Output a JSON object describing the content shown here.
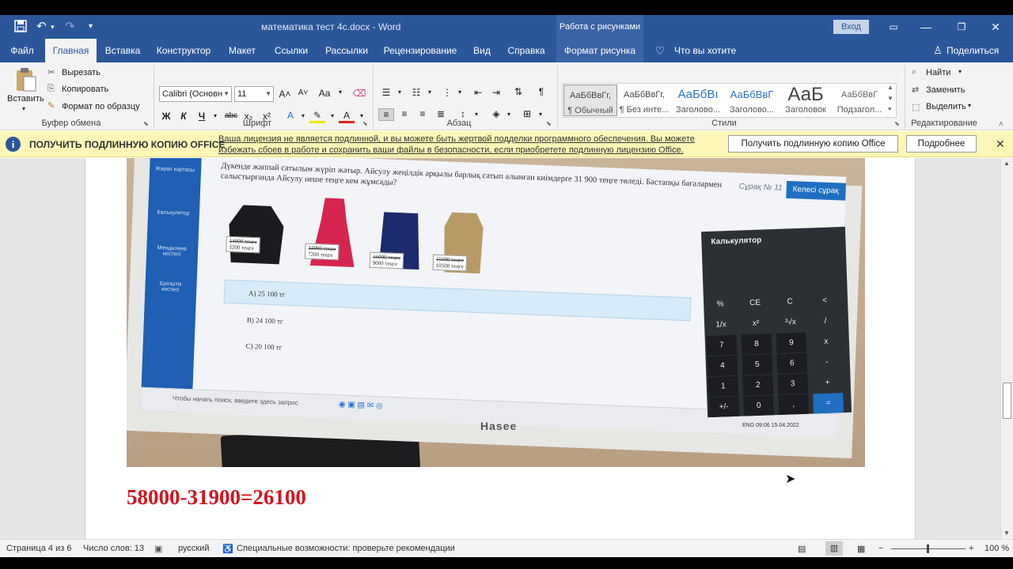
{
  "titlebar": {
    "doc_title": "математика тест 4с.docx  -  Word",
    "context_tab": "Работа с рисунками",
    "signin": "Вход"
  },
  "tabs": [
    {
      "label": "Файл"
    },
    {
      "label": "Главная"
    },
    {
      "label": "Вставка"
    },
    {
      "label": "Конструктор"
    },
    {
      "label": "Макет"
    },
    {
      "label": "Ссылки"
    },
    {
      "label": "Рассылки"
    },
    {
      "label": "Рецензирование"
    },
    {
      "label": "Вид"
    },
    {
      "label": "Справка"
    },
    {
      "label": "Формат рисунка"
    }
  ],
  "tell_me": "Что вы хотите сделать?",
  "share": "Поделиться",
  "clipboard": {
    "paste": "Вставить",
    "cut": "Вырезать",
    "copy": "Копировать",
    "format_painter": "Формат по образцу",
    "label": "Буфер обмена"
  },
  "font": {
    "name": "Calibri (Основн",
    "size": "11",
    "label": "Шрифт",
    "case_btn": "Аа"
  },
  "paragraph": {
    "label": "Абзац"
  },
  "styles": {
    "label": "Стили",
    "items": [
      {
        "sample": "АаБбВвГг,",
        "name": "¶ Обычный"
      },
      {
        "sample": "АаБбВвГг,",
        "name": "¶ Без инте..."
      },
      {
        "sample": "АаБбВı",
        "name": "Заголово..."
      },
      {
        "sample": "АаБбВвГ",
        "name": "Заголово..."
      },
      {
        "sample": "АаБ",
        "name": "Заголовок"
      },
      {
        "sample": "АаБбВвГ",
        "name": "Подзагол..."
      }
    ]
  },
  "editing": {
    "find": "Найти",
    "replace": "Заменить",
    "select": "Выделить",
    "label": "Редактирование"
  },
  "warning": {
    "title": "ПОЛУЧИТЬ ПОДЛИННУЮ КОПИЮ OFFICE",
    "message": "Ваша лицензия не является подлинной, и вы можете быть жертвой подделки программного обеспечения. Вы можете избежать сбоев в работе и сохранить ваши файлы в безопасности, если приобретете подлинную лицензию Office.",
    "get_button": "Получить подлинную копию Office",
    "more_button": "Подробнее"
  },
  "photo": {
    "question": "Дүкенде жаппай сатылым жүріп жатыр. Айсулу жеңілдік арқылы барлық сатып алынған киімдерге 31 900 теңге төледі. Бастапқы бағалармен салыстырғанда Айсулу неше теңге кем жұмсады?",
    "question_num": "Сұрақ № 11",
    "next_button": "Келесі сұрақ",
    "side_items": [
      "Жауап картасы",
      "Калькулятор",
      "Менделеев кестесі",
      "Ерігіштік кестесі"
    ],
    "prices": [
      [
        "14000 теңге",
        "3200 теңге"
      ],
      [
        "12000 теңге",
        "7200 теңге"
      ],
      [
        "16000 теңге",
        "9000 теңге"
      ],
      [
        "15000 теңге",
        "10500 теңге"
      ]
    ],
    "options": [
      "A)  25 100 тг",
      "B)  24 100 тг",
      "C)  20 100 тг"
    ],
    "taskbar_search": "Чтобы начать поиск, введите здесь запрос",
    "calc_title": "Калькулятор",
    "calc_keys": [
      [
        "%",
        "CE",
        "C",
        "<"
      ],
      [
        "1/x",
        "x²",
        "²√x",
        "/"
      ],
      [
        "7",
        "8",
        "9",
        "x"
      ],
      [
        "4",
        "5",
        "6",
        "-"
      ],
      [
        "1",
        "2",
        "3",
        "+"
      ],
      [
        "+/-",
        "0",
        ",",
        "="
      ]
    ],
    "brand": "Hasee",
    "tray_lang": "ENG",
    "tray_time": "09:06",
    "tray_date": "15.04.2022"
  },
  "answer_text": "58000-31900=26100",
  "statusbar": {
    "page": "Страница 4 из 6",
    "words": "Число слов: 13",
    "language": "русский",
    "accessibility": "Специальные возможности: проверьте рекомендации",
    "zoom": "100 %"
  },
  "colors": {
    "word_blue": "#2b579a",
    "warning_bg": "#fcf7b6",
    "answer_red": "#d5141f"
  }
}
